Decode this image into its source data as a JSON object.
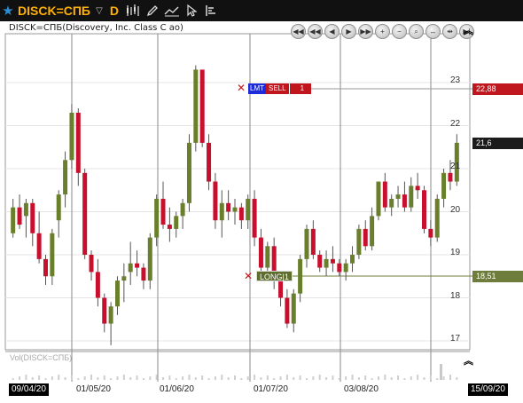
{
  "toolbar": {
    "ticker": "DISCK=СПБ",
    "period": "D",
    "icons": [
      "star-icon",
      "chevron-down-icon",
      "candlestick-icon",
      "pencil-icon",
      "drawing-tools-icon",
      "cursor-icon",
      "bar-list-icon"
    ]
  },
  "chart": {
    "title": "DISCK=СПБ(Discovery, Inc. Class C ао)",
    "y_ticks": [
      "23",
      "22",
      "21",
      "20",
      "19",
      "18",
      "17"
    ],
    "lmt_order": {
      "type": "LMT",
      "side": "SELL",
      "qty": "1",
      "price": "22,88"
    },
    "last_price": "21,6",
    "long_position": {
      "label": "LONG|1",
      "price": "18,51"
    },
    "volume_label": "Vol(DISCK=СПБ)",
    "x_ticks": [
      "09/04/20",
      "01/05/20",
      "01/06/20",
      "01/07/20",
      "03/08/20",
      "15/09/20"
    ],
    "colors": {
      "up": "#6a7f2c",
      "down": "#c8102e",
      "lmt": "#c0171f",
      "long": "#6f7d3c"
    }
  },
  "chart_data": {
    "type": "candlestick",
    "title": "DISCK=СПБ(Discovery, Inc. Class C ао)",
    "x_range": [
      "09/04/20",
      "15/09/20"
    ],
    "ylim": [
      16.6,
      23.6
    ],
    "grid": true,
    "candles": [
      {
        "o": 19.5,
        "h": 20.3,
        "l": 19.4,
        "c": 20.1
      },
      {
        "o": 20.1,
        "h": 20.4,
        "l": 19.6,
        "c": 19.7
      },
      {
        "o": 19.9,
        "h": 20.3,
        "l": 19.4,
        "c": 20.2
      },
      {
        "o": 20.2,
        "h": 20.3,
        "l": 19.2,
        "c": 19.5
      },
      {
        "o": 19.5,
        "h": 20.0,
        "l": 18.8,
        "c": 18.9
      },
      {
        "o": 18.9,
        "h": 19.0,
        "l": 18.3,
        "c": 18.5
      },
      {
        "o": 18.5,
        "h": 19.6,
        "l": 18.3,
        "c": 19.5
      },
      {
        "o": 19.8,
        "h": 20.5,
        "l": 19.4,
        "c": 20.4
      },
      {
        "o": 20.4,
        "h": 21.4,
        "l": 20.1,
        "c": 21.2
      },
      {
        "o": 21.2,
        "h": 22.5,
        "l": 21.0,
        "c": 22.3
      },
      {
        "o": 22.3,
        "h": 22.4,
        "l": 20.6,
        "c": 20.9
      },
      {
        "o": 20.9,
        "h": 21.0,
        "l": 18.9,
        "c": 19.0
      },
      {
        "o": 19.0,
        "h": 19.1,
        "l": 18.4,
        "c": 18.6
      },
      {
        "o": 18.6,
        "h": 18.9,
        "l": 17.8,
        "c": 18.0
      },
      {
        "o": 18.0,
        "h": 18.1,
        "l": 17.2,
        "c": 17.4
      },
      {
        "o": 17.4,
        "h": 17.9,
        "l": 16.9,
        "c": 17.8
      },
      {
        "o": 17.8,
        "h": 18.5,
        "l": 17.6,
        "c": 18.4
      },
      {
        "o": 18.4,
        "h": 18.8,
        "l": 17.9,
        "c": 18.5
      },
      {
        "o": 18.6,
        "h": 19.3,
        "l": 18.3,
        "c": 18.8
      },
      {
        "o": 18.8,
        "h": 19.1,
        "l": 18.5,
        "c": 18.7
      },
      {
        "o": 18.7,
        "h": 18.8,
        "l": 18.2,
        "c": 18.4
      },
      {
        "o": 18.4,
        "h": 19.5,
        "l": 18.2,
        "c": 19.4
      },
      {
        "o": 19.4,
        "h": 20.4,
        "l": 19.2,
        "c": 20.3
      },
      {
        "o": 20.3,
        "h": 20.7,
        "l": 19.6,
        "c": 19.7
      },
      {
        "o": 19.7,
        "h": 20.1,
        "l": 19.3,
        "c": 19.6
      },
      {
        "o": 19.6,
        "h": 20.0,
        "l": 19.4,
        "c": 19.9
      },
      {
        "o": 19.9,
        "h": 20.3,
        "l": 19.6,
        "c": 20.2
      },
      {
        "o": 20.2,
        "h": 21.8,
        "l": 20.0,
        "c": 21.6
      },
      {
        "o": 21.6,
        "h": 23.4,
        "l": 21.4,
        "c": 23.3
      },
      {
        "o": 23.3,
        "h": 23.2,
        "l": 21.5,
        "c": 21.6
      },
      {
        "o": 21.6,
        "h": 21.8,
        "l": 20.5,
        "c": 20.7
      },
      {
        "o": 20.7,
        "h": 20.9,
        "l": 19.6,
        "c": 19.8
      },
      {
        "o": 19.8,
        "h": 20.5,
        "l": 19.4,
        "c": 20.2
      },
      {
        "o": 20.2,
        "h": 20.5,
        "l": 19.8,
        "c": 20.0
      },
      {
        "o": 20.0,
        "h": 20.3,
        "l": 19.7,
        "c": 20.1
      },
      {
        "o": 20.1,
        "h": 20.2,
        "l": 19.6,
        "c": 19.8
      },
      {
        "o": 19.8,
        "h": 20.4,
        "l": 19.6,
        "c": 20.3
      },
      {
        "o": 20.3,
        "h": 20.5,
        "l": 19.2,
        "c": 19.4
      },
      {
        "o": 19.4,
        "h": 19.6,
        "l": 18.6,
        "c": 18.7
      },
      {
        "o": 18.7,
        "h": 19.3,
        "l": 18.5,
        "c": 19.2
      },
      {
        "o": 19.2,
        "h": 19.4,
        "l": 18.2,
        "c": 18.4
      },
      {
        "o": 18.4,
        "h": 18.6,
        "l": 17.8,
        "c": 18.0
      },
      {
        "o": 18.0,
        "h": 18.2,
        "l": 17.3,
        "c": 17.4
      },
      {
        "o": 17.4,
        "h": 18.2,
        "l": 17.2,
        "c": 18.1
      },
      {
        "o": 18.1,
        "h": 19.0,
        "l": 17.9,
        "c": 18.9
      },
      {
        "o": 18.9,
        "h": 19.7,
        "l": 18.7,
        "c": 19.6
      },
      {
        "o": 19.6,
        "h": 19.8,
        "l": 18.9,
        "c": 19.0
      },
      {
        "o": 19.0,
        "h": 19.1,
        "l": 18.6,
        "c": 18.7
      },
      {
        "o": 18.7,
        "h": 19.1,
        "l": 18.5,
        "c": 18.9
      },
      {
        "o": 18.9,
        "h": 19.2,
        "l": 18.6,
        "c": 18.8
      },
      {
        "o": 18.8,
        "h": 18.9,
        "l": 18.5,
        "c": 18.6
      },
      {
        "o": 18.6,
        "h": 18.9,
        "l": 18.4,
        "c": 18.8
      },
      {
        "o": 18.8,
        "h": 19.2,
        "l": 18.6,
        "c": 19.0
      },
      {
        "o": 19.0,
        "h": 19.7,
        "l": 18.9,
        "c": 19.6
      },
      {
        "o": 19.6,
        "h": 19.8,
        "l": 19.1,
        "c": 19.2
      },
      {
        "o": 19.2,
        "h": 20.1,
        "l": 19.1,
        "c": 19.9
      },
      {
        "o": 19.9,
        "h": 20.6,
        "l": 19.8,
        "c": 20.7
      },
      {
        "o": 20.7,
        "h": 20.9,
        "l": 20.0,
        "c": 20.1
      },
      {
        "o": 20.1,
        "h": 20.4,
        "l": 19.9,
        "c": 20.3
      },
      {
        "o": 20.3,
        "h": 20.6,
        "l": 20.1,
        "c": 20.4
      },
      {
        "o": 20.4,
        "h": 20.7,
        "l": 20.0,
        "c": 20.1
      },
      {
        "o": 20.1,
        "h": 20.8,
        "l": 20.0,
        "c": 20.6
      },
      {
        "o": 20.6,
        "h": 20.9,
        "l": 20.3,
        "c": 20.5
      },
      {
        "o": 20.5,
        "h": 20.6,
        "l": 19.5,
        "c": 19.6
      },
      {
        "o": 19.6,
        "h": 19.8,
        "l": 19.2,
        "c": 19.4
      },
      {
        "o": 19.4,
        "h": 20.4,
        "l": 19.3,
        "c": 20.3
      },
      {
        "o": 20.3,
        "h": 21.0,
        "l": 20.1,
        "c": 20.9
      },
      {
        "o": 20.9,
        "h": 21.2,
        "l": 20.5,
        "c": 20.7
      },
      {
        "o": 20.7,
        "h": 21.8,
        "l": 20.6,
        "c": 21.6
      }
    ]
  }
}
